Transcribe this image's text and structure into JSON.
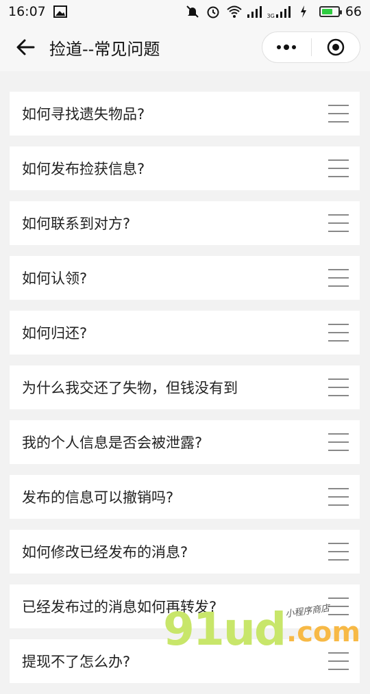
{
  "status_bar": {
    "time": "16:07",
    "network_label": "3G",
    "battery_text": "66",
    "battery_level": 0.66
  },
  "nav": {
    "title": "捡道--常见问题"
  },
  "faq_items": [
    "如何寻找遗失物品?",
    "如何发布捡获信息?",
    "如何联系到对方?",
    "如何认领?",
    "如何归还?",
    "为什么我交还了失物，但钱没有到",
    "我的个人信息是否会被泄露?",
    "发布的信息可以撤销吗?",
    "如何修改已经发布的消息?",
    "已经发布过的消息如何再转发?",
    "提现不了怎么办?"
  ],
  "watermark": {
    "main": "91ud",
    "domain": ".com",
    "sub": "小程序商店"
  }
}
